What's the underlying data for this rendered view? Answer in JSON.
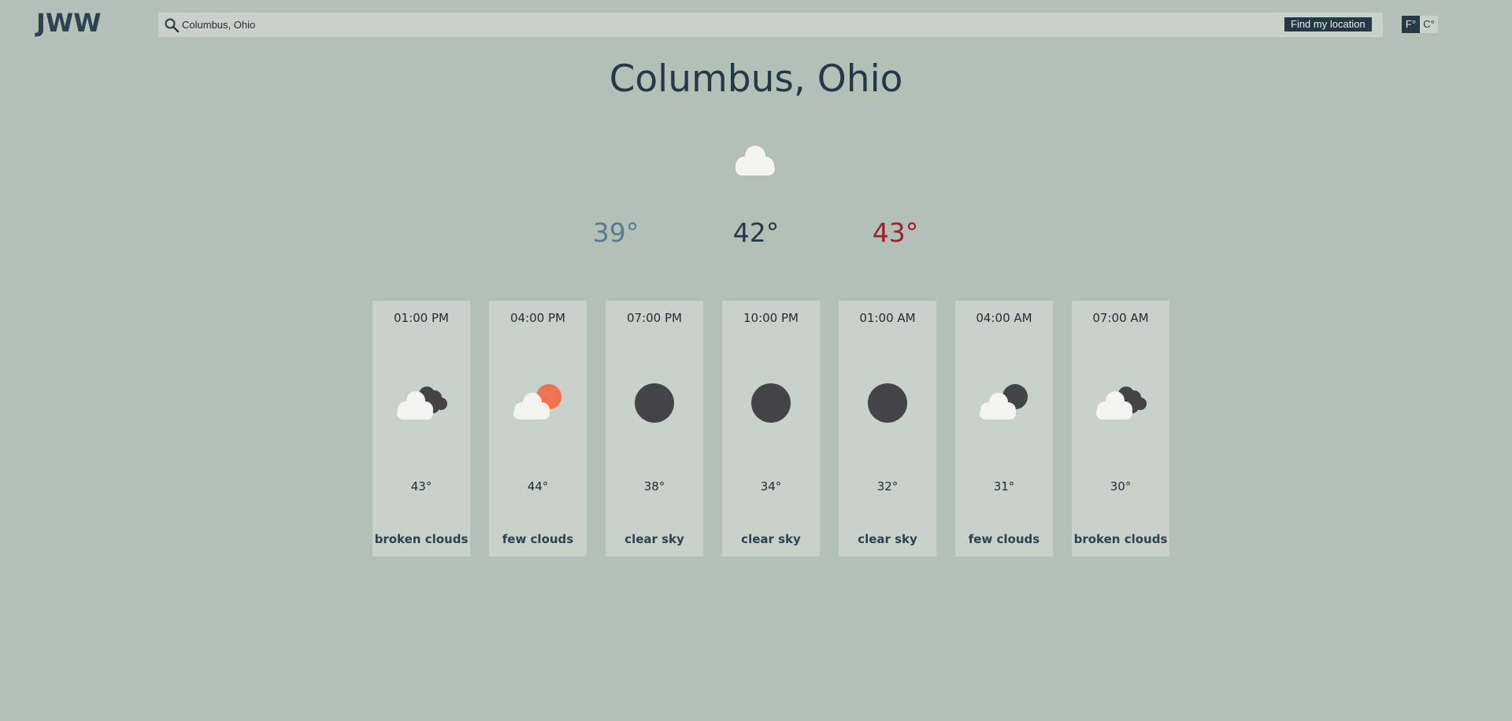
{
  "header": {
    "logo": "JWW",
    "search": {
      "value": "Columbus, Ohio",
      "icon": "search-icon"
    },
    "find_location_label": "Find my location",
    "units": {
      "fahrenheit": "F°",
      "celsius": "C°",
      "selected": "F°"
    }
  },
  "current": {
    "city": "Columbus, Ohio",
    "icon": "cloud-icon",
    "low": "39°",
    "current": "42°",
    "high": "43°"
  },
  "forecast": [
    {
      "time": "01:00 PM",
      "icon": "broken-clouds-icon",
      "temp": "43°",
      "desc": "broken clouds"
    },
    {
      "time": "04:00 PM",
      "icon": "few-clouds-day-icon",
      "temp": "44°",
      "desc": "few clouds"
    },
    {
      "time": "07:00 PM",
      "icon": "clear-night-icon",
      "temp": "38°",
      "desc": "clear sky"
    },
    {
      "time": "10:00 PM",
      "icon": "clear-night-icon",
      "temp": "34°",
      "desc": "clear sky"
    },
    {
      "time": "01:00 AM",
      "icon": "clear-night-icon",
      "temp": "32°",
      "desc": "clear sky"
    },
    {
      "time": "04:00 AM",
      "icon": "few-clouds-night-icon",
      "temp": "31°",
      "desc": "few clouds"
    },
    {
      "time": "07:00 AM",
      "icon": "broken-clouds-icon",
      "temp": "30°",
      "desc": "broken clouds"
    }
  ],
  "colors": {
    "background": "#b3c0b7",
    "panel": "#c8d1ca",
    "dark": "#243945",
    "low_temp": "#5b7a8f",
    "high_temp": "#a01f28",
    "sun": "#ef7350",
    "night": "#444446",
    "cloud": "#f4f4f2"
  }
}
